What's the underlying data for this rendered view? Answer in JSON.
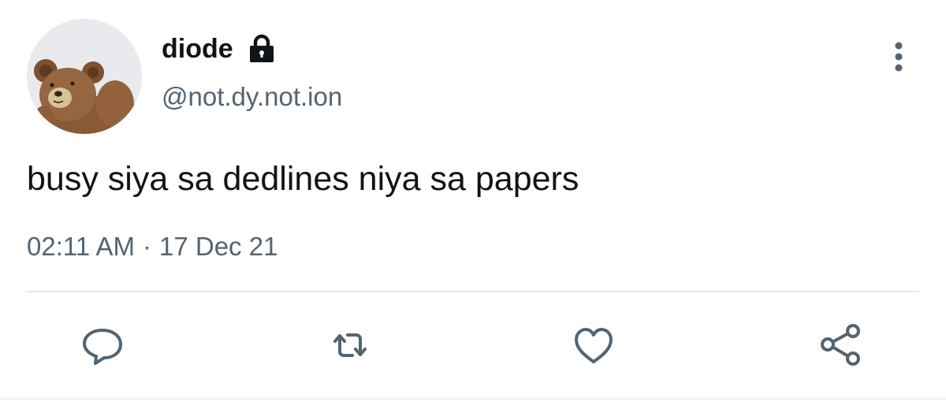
{
  "tweet": {
    "author": {
      "display_name": "diode",
      "handle": "@not.dy.not.ion",
      "protected_icon": "lock-icon",
      "avatar": "teddy-bear-avatar"
    },
    "text": "busy siya sa dedlines niya sa papers",
    "time": "02:11 AM",
    "separator": "·",
    "date": "17 Dec 21",
    "menu_icon": "vertical-dots-icon"
  },
  "actions": [
    {
      "name": "reply",
      "icon": "speech-bubble-icon"
    },
    {
      "name": "retweet",
      "icon": "retweet-icon"
    },
    {
      "name": "like",
      "icon": "heart-icon"
    },
    {
      "name": "share",
      "icon": "share-icon"
    }
  ],
  "colors": {
    "text_primary": "#0f1419",
    "text_secondary": "#536471",
    "icon": "#536471",
    "divider": "#e6e9ec"
  }
}
